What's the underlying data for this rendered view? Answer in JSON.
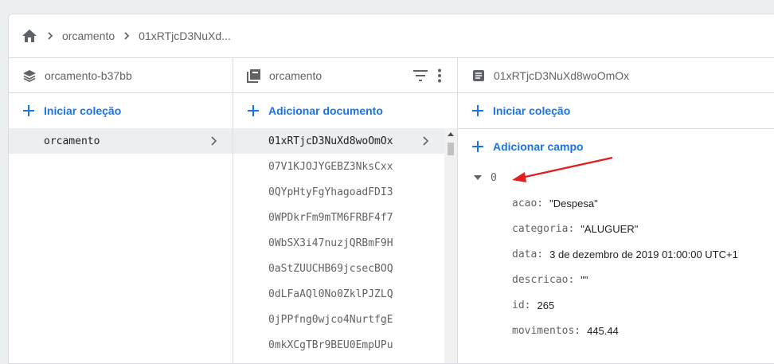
{
  "breadcrumb": {
    "home_icon": "home-icon",
    "items": [
      "orcamento",
      "01xRTjcD3NuXd..."
    ]
  },
  "columns": {
    "project": {
      "title": "orcamento-b37bb",
      "icon": "layers-icon",
      "action_label": "Iniciar coleção",
      "collections": [
        "orcamento"
      ]
    },
    "collection": {
      "title": "orcamento",
      "icon": "collection-icon",
      "action_label": "Adicionar documento",
      "documents": [
        "01xRTjcD3NuXd8woOmOx",
        "07V1KJOJYGEBZ3NksCxx",
        "0QYpHtyFgYhagoadFDI3",
        "0WPDkrFm9mTM6FRBF4f7",
        "0WbSX3i47nuzjQRBmF9H",
        "0aStZUUCHB69jcsecBOQ",
        "0dLFaAQl0No0ZklPJZLQ",
        "0jPPfng0wjco4NurtfgE",
        "0mkXCgTBr9BEU0EmpUPu"
      ]
    },
    "document": {
      "title": "01xRTjcD3NuXd8woOmOx",
      "icon": "document-icon",
      "start_collection_label": "Iniciar coleção",
      "add_field_label": "Adicionar campo",
      "root_key": "0",
      "fields": [
        {
          "key": "acao:",
          "value": "\"Despesa\""
        },
        {
          "key": "categoria:",
          "value": "\"ALUGUER\""
        },
        {
          "key": "data:",
          "value": "3 de dezembro de 2019 01:00:00 UTC+1"
        },
        {
          "key": "descricao:",
          "value": "\"\""
        },
        {
          "key": "id:",
          "value": "265"
        },
        {
          "key": "movimentos:",
          "value": "445.44"
        }
      ]
    }
  },
  "colors": {
    "accent": "#1a73e8",
    "annotation_arrow": "#e02020",
    "selected_bg": "#eceff1"
  }
}
